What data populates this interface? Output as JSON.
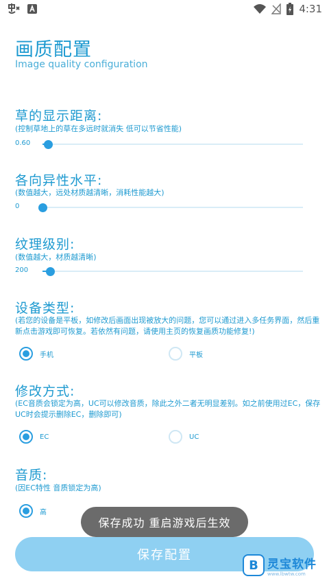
{
  "status_bar": {
    "time": "4:31",
    "left_icons": [
      "app-notification-icon",
      "a-letter-notification-icon"
    ],
    "right_icons": [
      "wifi-icon",
      "no-signal-icon",
      "battery-charging-icon"
    ]
  },
  "header": {
    "title": "画质配置",
    "subtitle": "Image quality configuration"
  },
  "sections": {
    "grass": {
      "title": "草的显示距离:",
      "desc": "(控制草地上的草在多远时就消失 低可以节省性能)",
      "value_label": "0.60",
      "fraction": 0.02
    },
    "aniso": {
      "title": "各向异性水平:",
      "desc": "(数值越大，远处材质越清晰，消耗性能越大)",
      "value_label": "0",
      "fraction": 0.0
    },
    "texture": {
      "title": "纹理级别:",
      "desc": "(数值越大，材质越清晰)",
      "value_label": "200",
      "fraction": 0.03
    },
    "device": {
      "title": "设备类型:",
      "desc": "(若您的设备是平板，如修改后画面出现被放大的问题，您可以通过进入多任务界面，然后重新点击游戏即可恢复。若依然有问题，请使用主页的恢复画质功能修复!)",
      "options": [
        {
          "label": "手机",
          "checked": true
        },
        {
          "label": "平板",
          "checked": false
        }
      ]
    },
    "mode": {
      "title": "修改方式:",
      "desc": "(EC音质会锁定为高，UC可以修改音质，除此之外二者无明显差别。如之前使用过EC，保存UC时会提示删除EC，删除即可)",
      "options": [
        {
          "label": "EC",
          "checked": true
        },
        {
          "label": "UC",
          "checked": false
        }
      ]
    },
    "sound": {
      "title": "音质:",
      "desc": "(因EC特性 音质锁定为高)",
      "options": [
        {
          "label": "高",
          "checked": true
        }
      ]
    }
  },
  "toast": {
    "text": "保存成功 重启游戏后生效"
  },
  "save_button": {
    "label": "保存配置"
  },
  "watermark": {
    "name": "灵宝软件",
    "url": "www.lbwtw.com"
  },
  "colors": {
    "accent": "#2a9ee0",
    "text": "#1e9ad0",
    "button": "#8fd0f2",
    "toast": "#6b6b6b"
  }
}
